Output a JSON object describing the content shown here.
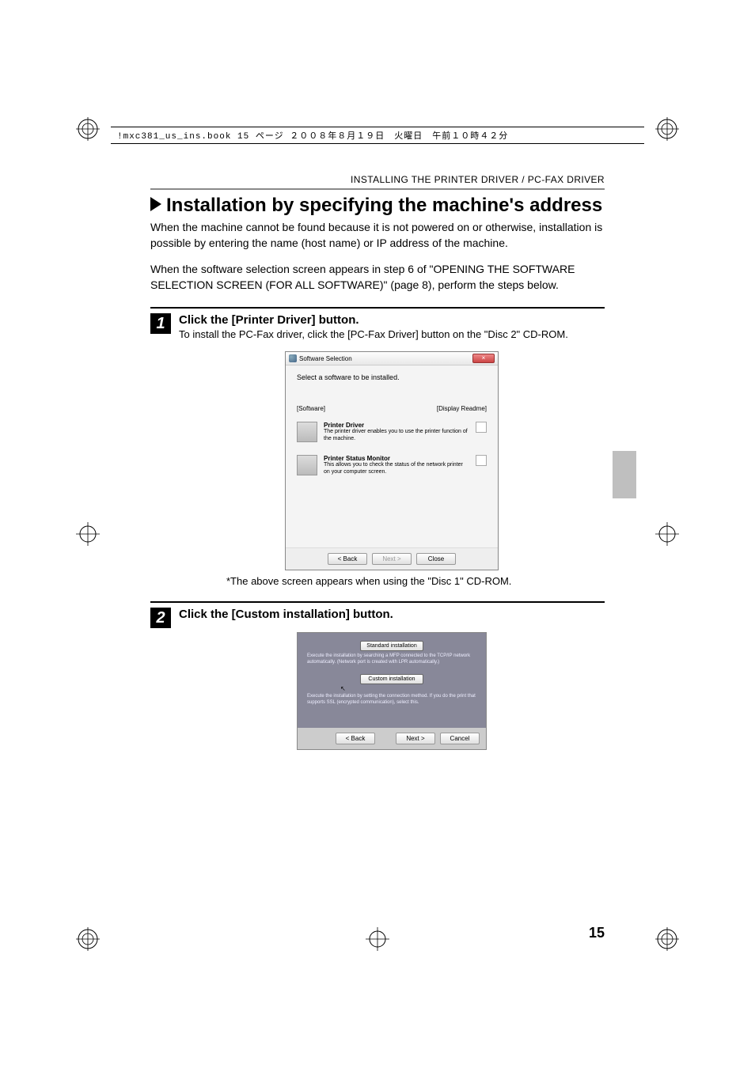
{
  "header_strip": "!mxc381_us_ins.book  15 ページ  ２００８年８月１９日　火曜日　午前１０時４２分",
  "breadcrumb": "INSTALLING THE PRINTER DRIVER / PC-FAX DRIVER",
  "section_title": "Installation by specifying the machine's address",
  "intro": "When the machine cannot be found because it is not powered on or otherwise, installation is possible by entering the name (host name) or IP address of the machine.",
  "intro2": "When the software selection screen appears in step 6 of \"OPENING THE SOFTWARE SELECTION SCREEN (FOR ALL SOFTWARE)\" (page 8), perform the steps below.",
  "steps": {
    "s1": {
      "num": "1",
      "title": "Click the [Printer Driver] button.",
      "desc": "To install the PC-Fax driver, click the [PC-Fax Driver] button on the \"Disc 2\" CD-ROM."
    },
    "s2": {
      "num": "2",
      "title": "Click the [Custom installation] button."
    }
  },
  "dialog1": {
    "title": "Software Selection",
    "prompt": "Select a software to be installed.",
    "label_software": "[Software]",
    "label_readme": "[Display Readme]",
    "items": {
      "printer_driver": {
        "title": "Printer Driver",
        "desc": "The printer driver enables you to use the printer function of the machine."
      },
      "status_monitor": {
        "title": "Printer Status Monitor",
        "desc": "This allows you to check the status of the network printer on your computer screen."
      }
    },
    "buttons": {
      "back": "< Back",
      "next": "Next >",
      "close": "Close"
    }
  },
  "caption1": "*The above screen appears when using the \"Disc 1\" CD-ROM.",
  "dialog2": {
    "standard_btn": "Standard installation",
    "standard_desc": "Execute the installation by searching a MFP connected to the TCP/IP network automatically. (Network port is created with LPR automatically.)",
    "custom_btn": "Custom installation",
    "custom_desc": "Execute the installation by setting the connection method. If you do the print that supports SSL (encrypted communication), select this.",
    "buttons": {
      "back": "< Back",
      "next": "Next >",
      "cancel": "Cancel"
    }
  },
  "page_number": "15"
}
